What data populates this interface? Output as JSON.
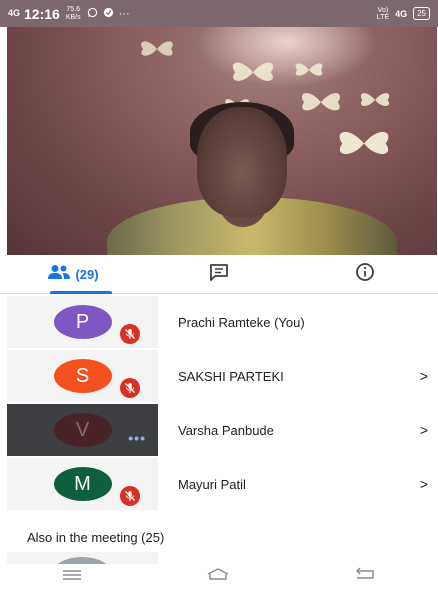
{
  "status_bar": {
    "network": "4G",
    "time": "12:16",
    "speed_value": "75.6",
    "speed_unit": "KB/s",
    "extra": "···",
    "volte": "Vo)\nLTE",
    "signal": "4G",
    "battery": "25"
  },
  "tabs": {
    "people_count": "(29)",
    "active": "people"
  },
  "participants": [
    {
      "initial": "P",
      "name": "Prachi Ramteke (You)",
      "color": "#7e57c2",
      "muted": true,
      "chevron": ""
    },
    {
      "initial": "S",
      "name": "SAKSHI PARTEKI",
      "color": "#f4511e",
      "muted": true,
      "chevron": ">"
    },
    {
      "initial": "V",
      "name": "Varsha Panbude",
      "color": "#4a2329",
      "muted": false,
      "speaking": true,
      "chevron": ">"
    },
    {
      "initial": "M",
      "name": "Mayuri Patil",
      "color": "#0d5f3d",
      "muted": true,
      "chevron": ">"
    }
  ],
  "section": {
    "also_in_meeting": "Also in the meeting (25)"
  },
  "icons": {
    "people": "people-icon",
    "chat": "chat-icon",
    "info": "info-icon",
    "mic_off": "mic-off-icon"
  },
  "colors": {
    "accent": "#1a73e8",
    "muted_badge": "#d93025"
  }
}
